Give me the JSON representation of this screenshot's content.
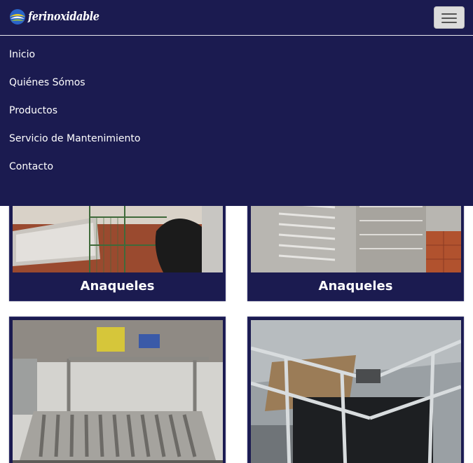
{
  "brand": {
    "name": "ferinoxidable",
    "logo_icon": "brand-globe-icon"
  },
  "navbar": {
    "toggle_icon": "hamburger-menu-icon",
    "items": [
      {
        "label": "Inicio"
      },
      {
        "label": "Quiénes Sómos"
      },
      {
        "label": "Productos"
      },
      {
        "label": "Servicio de Mantenimiento"
      },
      {
        "label": "Contacto"
      }
    ]
  },
  "products": [
    {
      "label": "Anaqueles"
    },
    {
      "label": "Anaqueles"
    },
    {
      "label": ""
    },
    {
      "label": ""
    }
  ],
  "colors": {
    "navbar_bg": "#1b1b50",
    "card_bg": "#1b1b50",
    "text": "#ffffff"
  }
}
